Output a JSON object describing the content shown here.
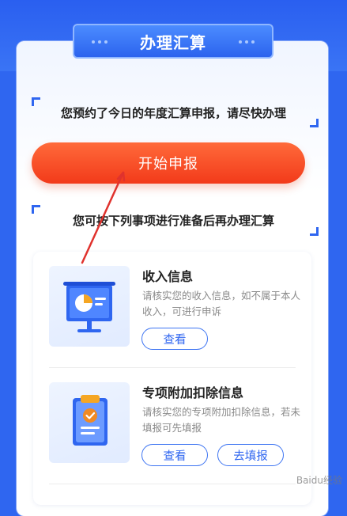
{
  "header": {
    "title": "办理汇算"
  },
  "notice": {
    "reserved_text": "您预约了今日的年度汇算申报，请尽快办理"
  },
  "start_button": {
    "label": "开始申报"
  },
  "prep": {
    "text": "您可按下列事项进行准备后再办理汇算"
  },
  "items": [
    {
      "title": "收入信息",
      "desc": "请核实您的收入信息，如不属于本人收入，可进行申诉",
      "view_label": "查看"
    },
    {
      "title": "专项附加扣除信息",
      "desc": "请核实您的专项附加扣除信息，若未填报可先填报",
      "view_label": "查看",
      "fill_label": "去填报"
    }
  ],
  "watermark": {
    "text": "Baidu经验"
  },
  "colors": {
    "primary": "#2f66f0",
    "start": "#f23a1a",
    "arrow": "#e0322d"
  }
}
